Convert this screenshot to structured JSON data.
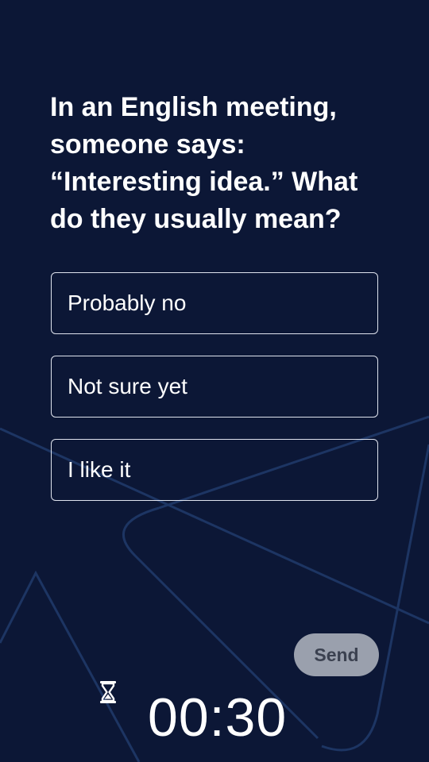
{
  "question": {
    "text": "In an English meeting, someone says: “Interesting idea.” What do they usually mean?"
  },
  "options": [
    {
      "label": "Probably no"
    },
    {
      "label": "Not sure yet"
    },
    {
      "label": "I like it"
    }
  ],
  "send_button": {
    "label": "Send"
  },
  "timer": {
    "value": "00:30",
    "icon": "hourglass-icon"
  },
  "colors": {
    "background": "#0c1736",
    "decor_lines": "#1d3563",
    "option_border": "#dfe3ee",
    "send_bg": "#9aa0ad",
    "send_text": "#3b4150"
  }
}
